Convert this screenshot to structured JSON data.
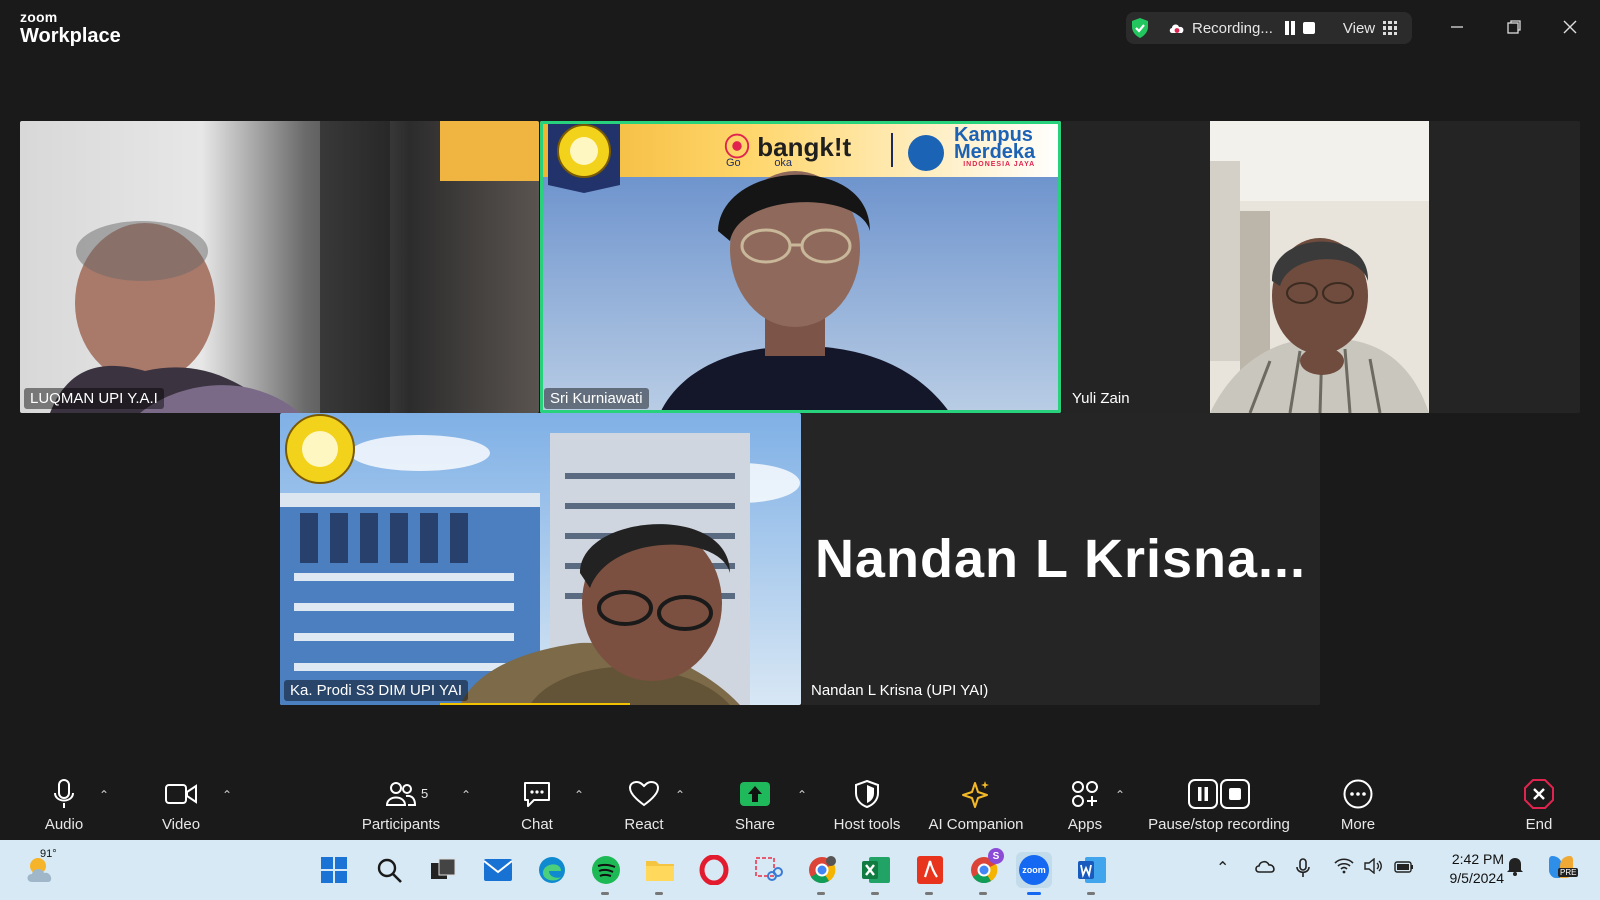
{
  "app": {
    "brand_small": "zoom",
    "brand_large": "Workplace"
  },
  "recording": {
    "status": "Recording...",
    "view_label": "View"
  },
  "participants": [
    {
      "name": "LUQMAN UPI Y.A.I"
    },
    {
      "name": "Sri Kurniawati"
    },
    {
      "name": "Yuli Zain"
    },
    {
      "name": "Ka. Prodi S3 DIM UPI YAI"
    },
    {
      "name": "Nandan L Krisna (UPI YAI)",
      "display_title": "Nandan L Krisna..."
    }
  ],
  "banner": {
    "left_brand": "bangk!t",
    "left_sub": "Go",
    "left_sub2": "oka",
    "right_brand_1": "Kampus",
    "right_brand_2": "Merdeka",
    "right_sub": "INDONESIA JAYA"
  },
  "toolbar": {
    "audio": "Audio",
    "video": "Video",
    "participants": "Participants",
    "participants_count": "5",
    "chat": "Chat",
    "react": "React",
    "share": "Share",
    "host_tools": "Host tools",
    "ai_companion": "AI Companion",
    "apps": "Apps",
    "pause_stop": "Pause/stop recording",
    "more": "More",
    "end": "End"
  },
  "taskbar": {
    "temperature": "91°",
    "time": "2:42 PM",
    "date": "9/5/2024",
    "zoom_icon": "zoom",
    "copilot_badge": "PRE",
    "chrome_badge": "S"
  },
  "colors": {
    "speaker_border": "#28d17c",
    "share_green": "#1fb85a",
    "end_red": "#e0244f"
  }
}
